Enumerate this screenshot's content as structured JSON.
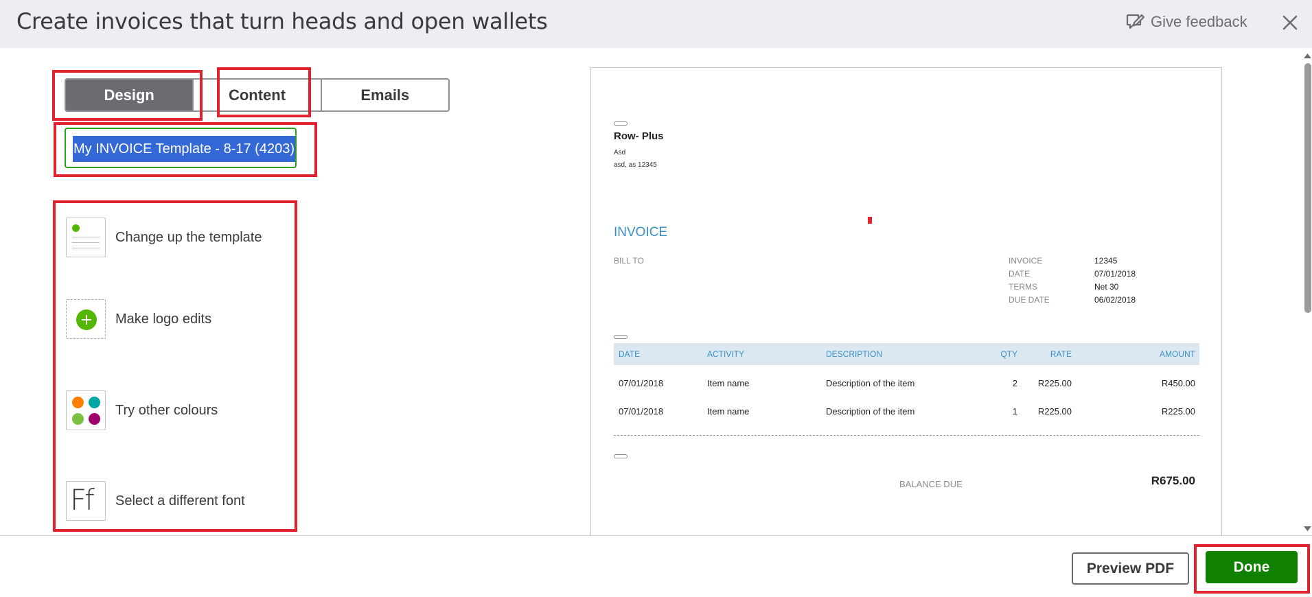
{
  "header": {
    "title": "Create invoices that turn heads and open wallets",
    "feedback_label": "Give feedback"
  },
  "tabs": [
    {
      "label": "Design",
      "active": true
    },
    {
      "label": "Content"
    },
    {
      "label": "Emails"
    }
  ],
  "template_name": "My INVOICE Template - 8-17 (4203)",
  "options": [
    {
      "label": "Change up the template",
      "icon": "template-icon"
    },
    {
      "label": "Make logo edits",
      "icon": "add-logo-icon"
    },
    {
      "label": "Try other colours",
      "icon": "colour-palette-icon"
    },
    {
      "label": "Select a different font",
      "icon": "font-icon",
      "glyph": "Ff"
    }
  ],
  "invoice": {
    "company": "Row- Plus",
    "address1": "Asd",
    "address2": "asd, as 12345",
    "heading": "INVOICE",
    "bill_to": "BILL TO",
    "meta": [
      {
        "label": "INVOICE",
        "value": "12345"
      },
      {
        "label": "DATE",
        "value": "07/01/2018"
      },
      {
        "label": "TERMS",
        "value": "Net 30"
      },
      {
        "label": "DUE DATE",
        "value": "06/02/2018"
      }
    ],
    "columns": [
      "DATE",
      "ACTIVITY",
      "DESCRIPTION",
      "QTY",
      "RATE",
      "AMOUNT"
    ],
    "rows": [
      {
        "date": "07/01/2018",
        "activity": "Item name",
        "description": "Description of the item",
        "qty": "2",
        "rate": "R225.00",
        "amount": "R450.00"
      },
      {
        "date": "07/01/2018",
        "activity": "Item name",
        "description": "Description of the item",
        "qty": "1",
        "rate": "R225.00",
        "amount": "R225.00"
      }
    ],
    "balance_label": "BALANCE DUE",
    "balance_value": "R675.00"
  },
  "footer": {
    "preview_label": "Preview PDF",
    "done_label": "Done"
  },
  "colors": {
    "accent_green": "#108000",
    "input_green": "#2ca01c",
    "invoice_blue": "#3b8fc4",
    "highlight_red": "#e0232f"
  }
}
